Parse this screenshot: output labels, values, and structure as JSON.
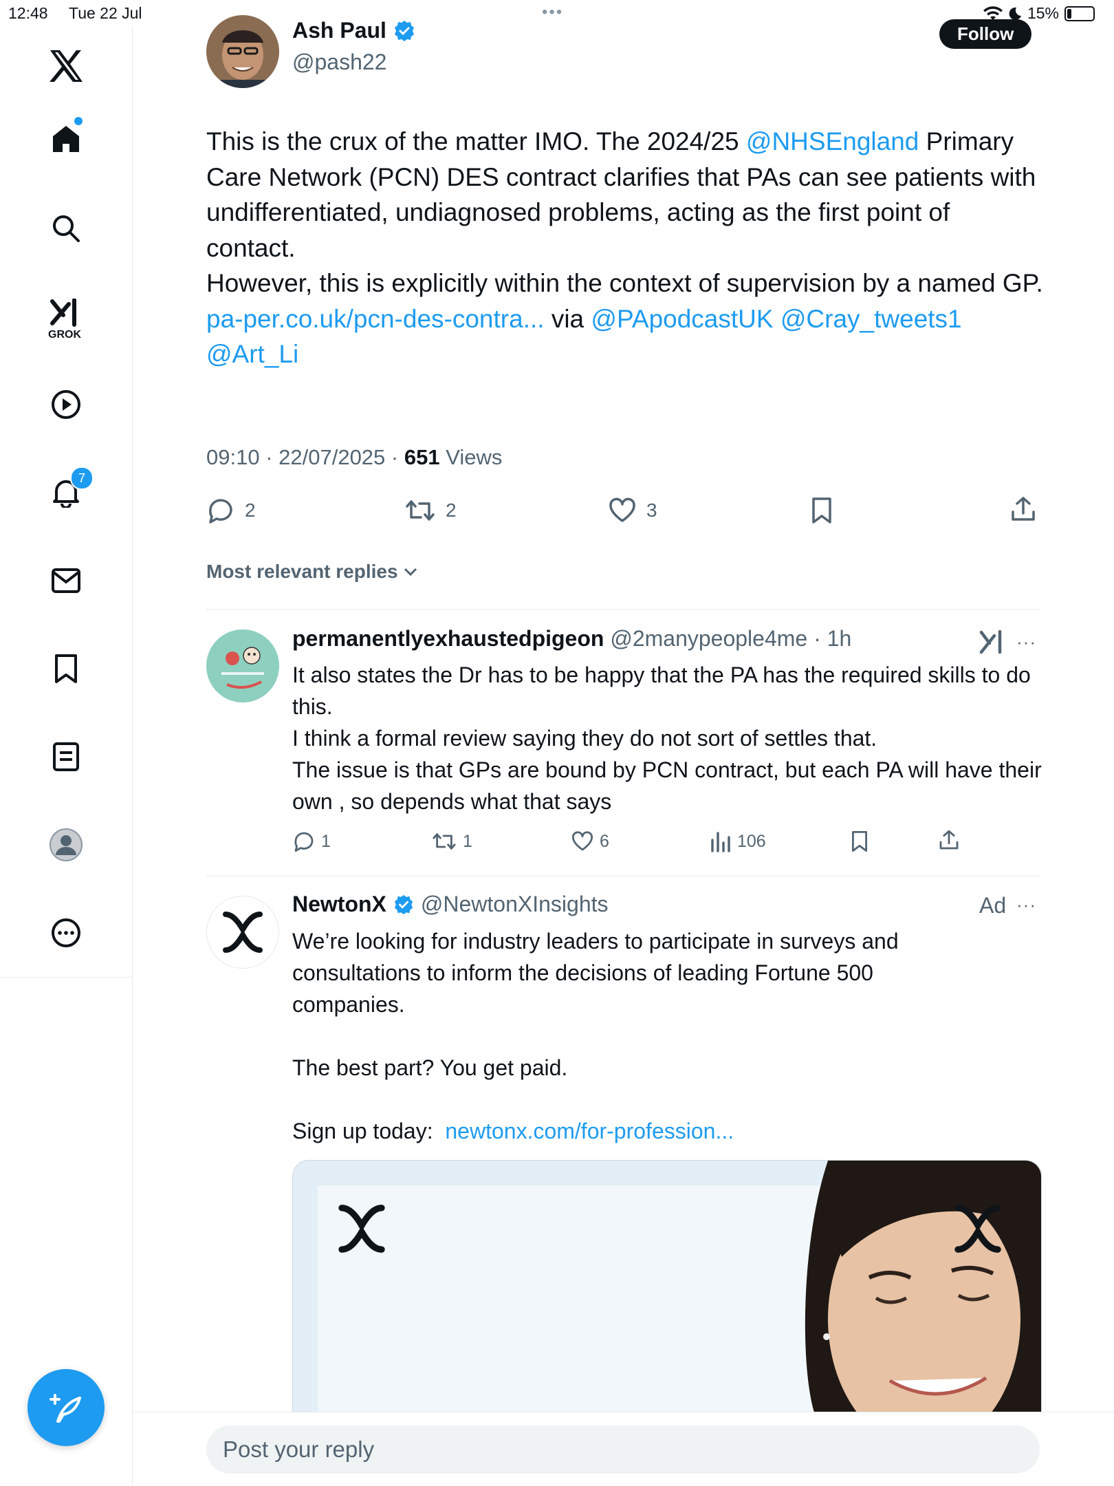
{
  "status_bar": {
    "time": "12:48",
    "date": "Tue 22 Jul",
    "battery": "15%"
  },
  "sidebar": {
    "grok_label": "GROK",
    "notifications_count": "7"
  },
  "tweet": {
    "name": "Ash Paul",
    "handle": "@pash22",
    "follow_label": "Follow",
    "text_1": "This is the crux of the matter IMO. The 2024/25 ",
    "mention_nhs": "@NHSEngland",
    "text_2": " Primary Care Network (PCN) DES contract clarifies that PAs can see patients with undifferentiated, undiagnosed problems, acting as the first point of contact.",
    "text_3": "However, this is explicitly within the context of supervision by a named GP.",
    "link": "pa-per.co.uk/pcn-des-contra...",
    "via": " via ",
    "mention_1": "@PApodcastUK",
    "mention_2": "@Cray_tweets1",
    "mention_3": "@Art_Li",
    "time": "09:10",
    "date": "22/07/2025",
    "views": "651",
    "views_label": "Views",
    "replies": "2",
    "reposts": "2",
    "likes": "3"
  },
  "replies_header": "Most relevant replies",
  "reply": {
    "name": "permanentlyexhaustedpigeon",
    "handle": "@2manypeople4me",
    "age": "1h",
    "line_1": "It also states the Dr has to be happy that the PA has the required skills to do this.",
    "line_2": "I think a formal review saying they do not sort of settles that.",
    "line_3": "The issue is that GPs are bound by PCN contract, but each PA will have their own , so depends what that says",
    "replies": "1",
    "reposts": "1",
    "likes": "6",
    "views": "106"
  },
  "ad": {
    "name": "NewtonX",
    "handle": "@NewtonXInsights",
    "ad_label": "Ad",
    "para_1": "We’re looking for industry leaders to participate in surveys and consultations to inform the decisions of leading Fortune 500 companies.",
    "para_2": "The best part?  You get paid.",
    "signup": "Sign up today:  ",
    "link": "newtonx.com/for-profession..."
  },
  "reply_placeholder": "Post your reply"
}
